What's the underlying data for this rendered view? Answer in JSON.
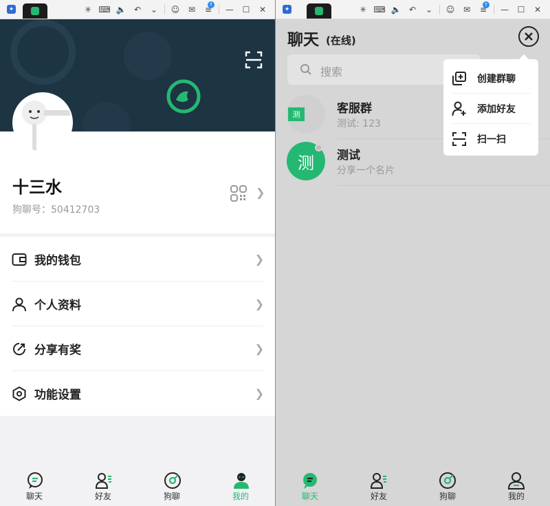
{
  "left": {
    "profile": {
      "name": "十三水",
      "id_label": "狗聊号：50412703"
    },
    "menu": [
      {
        "label": "我的钱包",
        "icon": "wallet-icon"
      },
      {
        "label": "个人资料",
        "icon": "person-icon"
      },
      {
        "label": "分享有奖",
        "icon": "share-icon"
      },
      {
        "label": "功能设置",
        "icon": "settings-icon"
      }
    ],
    "nav": [
      {
        "label": "聊天",
        "icon": "chat-icon",
        "active": false
      },
      {
        "label": "好友",
        "icon": "friends-icon",
        "active": false
      },
      {
        "label": "狗聊",
        "icon": "discover-icon",
        "active": false
      },
      {
        "label": "我的",
        "icon": "me-icon",
        "active": true
      }
    ]
  },
  "right": {
    "title": "聊天",
    "status": "(在线)",
    "search_placeholder": "搜索",
    "conversations": [
      {
        "avatar_text": "测",
        "name": "客服群",
        "message": "测试: 123",
        "avatar_color": "#d0d0d0"
      },
      {
        "avatar_text": "测",
        "name": "测试",
        "message": "分享一个名片",
        "avatar_color": "#25b872"
      }
    ],
    "popup": [
      {
        "label": "创建群聊",
        "icon": "create-group-icon"
      },
      {
        "label": "添加好友",
        "icon": "add-friend-icon"
      },
      {
        "label": "扫一扫",
        "icon": "scan-icon"
      }
    ],
    "nav": [
      {
        "label": "聊天",
        "icon": "chat-icon",
        "active": true
      },
      {
        "label": "好友",
        "icon": "friends-icon",
        "active": false
      },
      {
        "label": "狗聊",
        "icon": "discover-icon",
        "active": false
      },
      {
        "label": "我的",
        "icon": "me-icon",
        "active": false
      }
    ]
  },
  "colors": {
    "accent": "#25b872",
    "banner": "#1d3443"
  }
}
